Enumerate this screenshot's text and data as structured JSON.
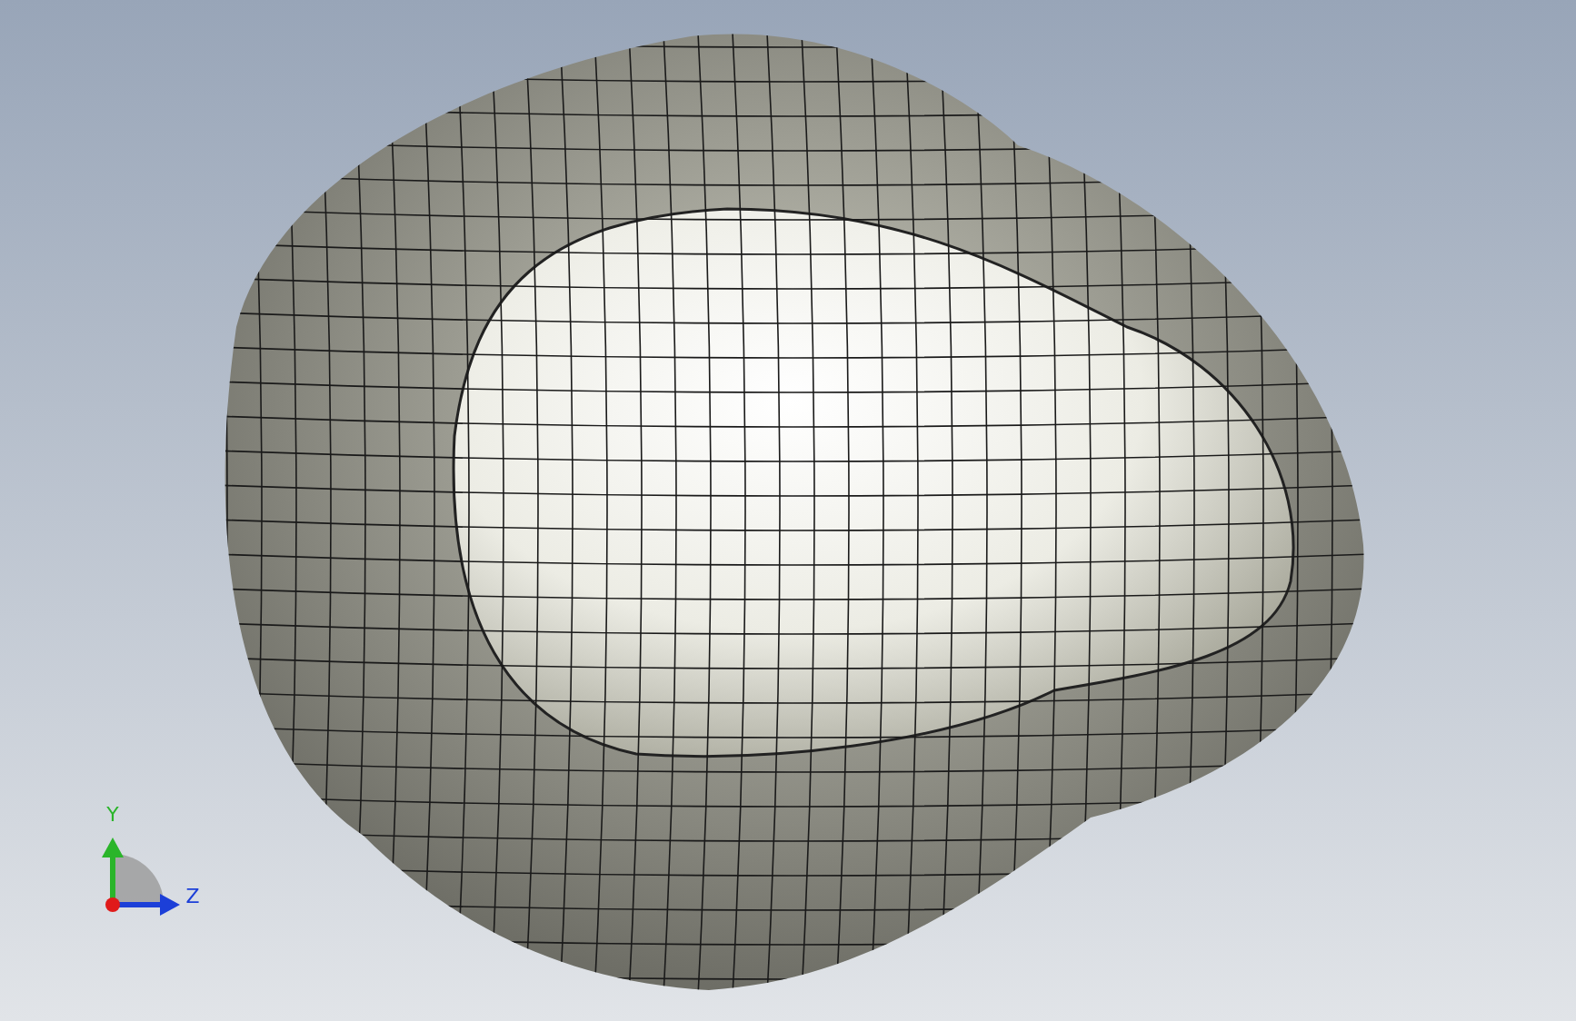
{
  "viewport": {
    "axis_triad": {
      "y_label": "Y",
      "z_label": "Z"
    }
  }
}
